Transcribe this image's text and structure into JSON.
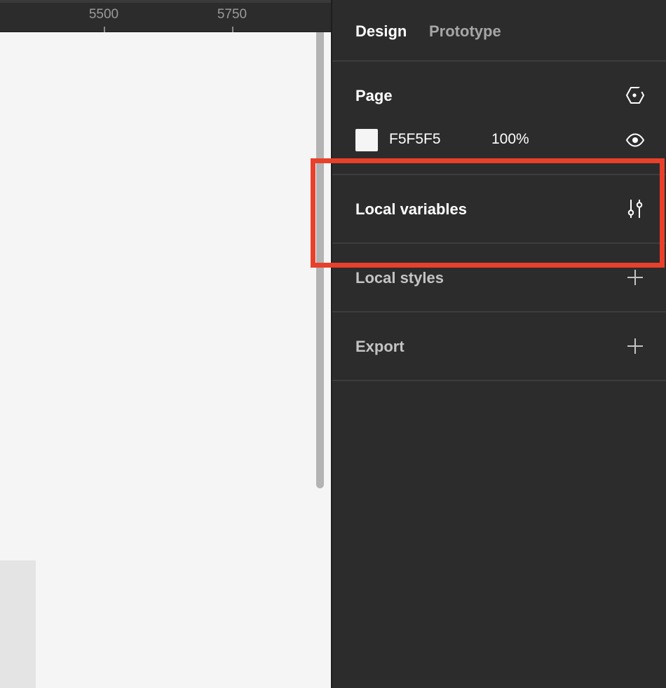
{
  "ruler": {
    "labels": [
      "5500",
      "5750"
    ]
  },
  "panel": {
    "tabs": [
      {
        "label": "Design",
        "active": true
      },
      {
        "label": "Prototype",
        "active": false
      }
    ],
    "page": {
      "title": "Page",
      "fill_hex": "F5F5F5",
      "fill_opacity": "100%",
      "swatch_color": "#F5F5F5",
      "style_icon": "style-library-icon",
      "visibility_icon": "eye-icon"
    },
    "local_variables": {
      "title": "Local variables",
      "icon": "sliders-icon"
    },
    "local_styles": {
      "title": "Local styles",
      "icon": "plus-icon"
    },
    "export": {
      "title": "Export",
      "icon": "plus-icon"
    }
  },
  "colors": {
    "panel_bg": "#2C2C2C",
    "canvas_bg": "#F5F5F5",
    "highlight": "#E8402A"
  }
}
